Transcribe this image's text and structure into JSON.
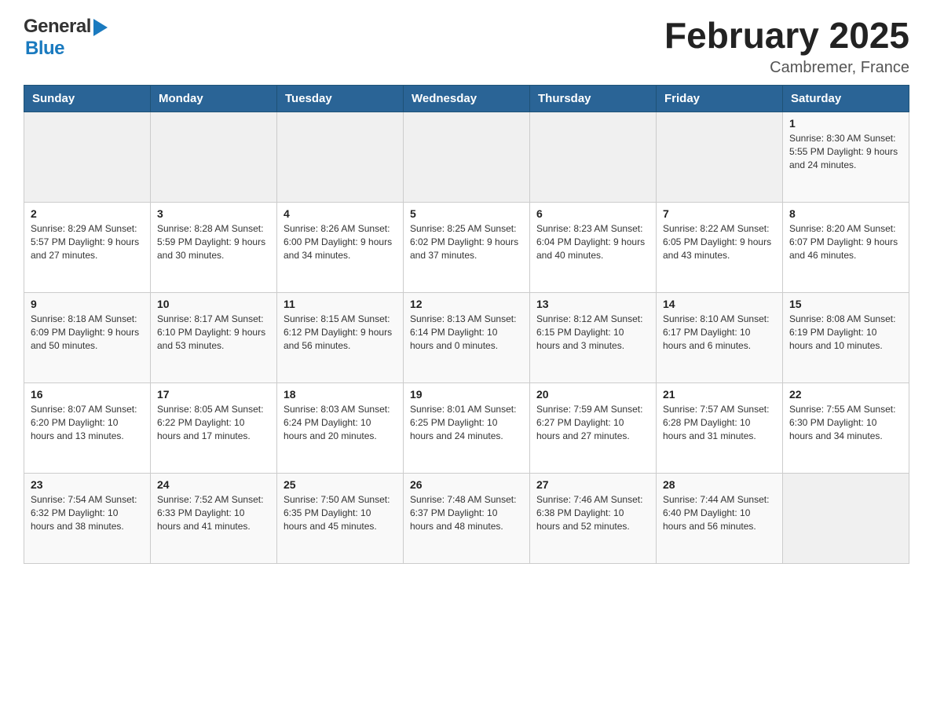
{
  "logo": {
    "general": "General",
    "blue": "Blue"
  },
  "header": {
    "title": "February 2025",
    "location": "Cambremer, France"
  },
  "weekdays": [
    "Sunday",
    "Monday",
    "Tuesday",
    "Wednesday",
    "Thursday",
    "Friday",
    "Saturday"
  ],
  "weeks": [
    [
      {
        "day": "",
        "info": ""
      },
      {
        "day": "",
        "info": ""
      },
      {
        "day": "",
        "info": ""
      },
      {
        "day": "",
        "info": ""
      },
      {
        "day": "",
        "info": ""
      },
      {
        "day": "",
        "info": ""
      },
      {
        "day": "1",
        "info": "Sunrise: 8:30 AM\nSunset: 5:55 PM\nDaylight: 9 hours and 24 minutes."
      }
    ],
    [
      {
        "day": "2",
        "info": "Sunrise: 8:29 AM\nSunset: 5:57 PM\nDaylight: 9 hours and 27 minutes."
      },
      {
        "day": "3",
        "info": "Sunrise: 8:28 AM\nSunset: 5:59 PM\nDaylight: 9 hours and 30 minutes."
      },
      {
        "day": "4",
        "info": "Sunrise: 8:26 AM\nSunset: 6:00 PM\nDaylight: 9 hours and 34 minutes."
      },
      {
        "day": "5",
        "info": "Sunrise: 8:25 AM\nSunset: 6:02 PM\nDaylight: 9 hours and 37 minutes."
      },
      {
        "day": "6",
        "info": "Sunrise: 8:23 AM\nSunset: 6:04 PM\nDaylight: 9 hours and 40 minutes."
      },
      {
        "day": "7",
        "info": "Sunrise: 8:22 AM\nSunset: 6:05 PM\nDaylight: 9 hours and 43 minutes."
      },
      {
        "day": "8",
        "info": "Sunrise: 8:20 AM\nSunset: 6:07 PM\nDaylight: 9 hours and 46 minutes."
      }
    ],
    [
      {
        "day": "9",
        "info": "Sunrise: 8:18 AM\nSunset: 6:09 PM\nDaylight: 9 hours and 50 minutes."
      },
      {
        "day": "10",
        "info": "Sunrise: 8:17 AM\nSunset: 6:10 PM\nDaylight: 9 hours and 53 minutes."
      },
      {
        "day": "11",
        "info": "Sunrise: 8:15 AM\nSunset: 6:12 PM\nDaylight: 9 hours and 56 minutes."
      },
      {
        "day": "12",
        "info": "Sunrise: 8:13 AM\nSunset: 6:14 PM\nDaylight: 10 hours and 0 minutes."
      },
      {
        "day": "13",
        "info": "Sunrise: 8:12 AM\nSunset: 6:15 PM\nDaylight: 10 hours and 3 minutes."
      },
      {
        "day": "14",
        "info": "Sunrise: 8:10 AM\nSunset: 6:17 PM\nDaylight: 10 hours and 6 minutes."
      },
      {
        "day": "15",
        "info": "Sunrise: 8:08 AM\nSunset: 6:19 PM\nDaylight: 10 hours and 10 minutes."
      }
    ],
    [
      {
        "day": "16",
        "info": "Sunrise: 8:07 AM\nSunset: 6:20 PM\nDaylight: 10 hours and 13 minutes."
      },
      {
        "day": "17",
        "info": "Sunrise: 8:05 AM\nSunset: 6:22 PM\nDaylight: 10 hours and 17 minutes."
      },
      {
        "day": "18",
        "info": "Sunrise: 8:03 AM\nSunset: 6:24 PM\nDaylight: 10 hours and 20 minutes."
      },
      {
        "day": "19",
        "info": "Sunrise: 8:01 AM\nSunset: 6:25 PM\nDaylight: 10 hours and 24 minutes."
      },
      {
        "day": "20",
        "info": "Sunrise: 7:59 AM\nSunset: 6:27 PM\nDaylight: 10 hours and 27 minutes."
      },
      {
        "day": "21",
        "info": "Sunrise: 7:57 AM\nSunset: 6:28 PM\nDaylight: 10 hours and 31 minutes."
      },
      {
        "day": "22",
        "info": "Sunrise: 7:55 AM\nSunset: 6:30 PM\nDaylight: 10 hours and 34 minutes."
      }
    ],
    [
      {
        "day": "23",
        "info": "Sunrise: 7:54 AM\nSunset: 6:32 PM\nDaylight: 10 hours and 38 minutes."
      },
      {
        "day": "24",
        "info": "Sunrise: 7:52 AM\nSunset: 6:33 PM\nDaylight: 10 hours and 41 minutes."
      },
      {
        "day": "25",
        "info": "Sunrise: 7:50 AM\nSunset: 6:35 PM\nDaylight: 10 hours and 45 minutes."
      },
      {
        "day": "26",
        "info": "Sunrise: 7:48 AM\nSunset: 6:37 PM\nDaylight: 10 hours and 48 minutes."
      },
      {
        "day": "27",
        "info": "Sunrise: 7:46 AM\nSunset: 6:38 PM\nDaylight: 10 hours and 52 minutes."
      },
      {
        "day": "28",
        "info": "Sunrise: 7:44 AM\nSunset: 6:40 PM\nDaylight: 10 hours and 56 minutes."
      },
      {
        "day": "",
        "info": ""
      }
    ]
  ]
}
